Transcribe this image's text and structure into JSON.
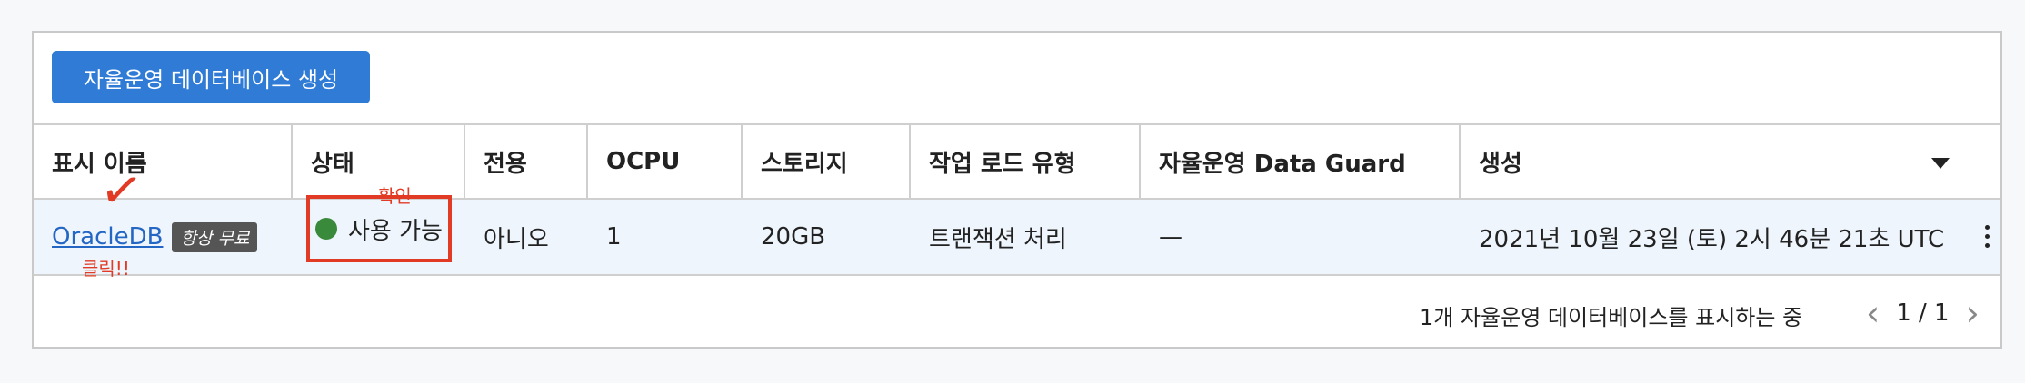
{
  "toolbar": {
    "create_label": "자율운영 데이터베이스 생성"
  },
  "table": {
    "headers": [
      "표시 이름",
      "상태",
      "전용",
      "OCPU",
      "스토리지",
      "작업 로드 유형",
      "자율운영 Data Guard",
      "생성"
    ],
    "row": {
      "name": "OracleDB",
      "badge": "항상 무료",
      "status": "사용 가능",
      "dedicated": "아니오",
      "ocpu": "1",
      "storage": "20GB",
      "workload": "트랜잭션 처리",
      "data_guard": "—",
      "created": "2021년 10월 23일 (토) 2시 46분 21초 UTC"
    }
  },
  "footer": {
    "summary": "1개 자율운영 데이터베이스를 표시하는 중",
    "page": "1 / 1",
    "prev_glyph": "‹",
    "next_glyph": "›"
  },
  "annotations": {
    "click_note": "클릭!!",
    "confirm_note": "확인",
    "check_mark": "✓"
  },
  "colors": {
    "accent": "#2f7bd6",
    "status_ok": "#3a8a3c",
    "annotation": "#e23b25",
    "link": "#2366c4"
  },
  "icons": [
    "sort-down-icon",
    "status-dot-icon",
    "kebab-menu-icon",
    "chevron-left-icon",
    "chevron-right-icon"
  ]
}
